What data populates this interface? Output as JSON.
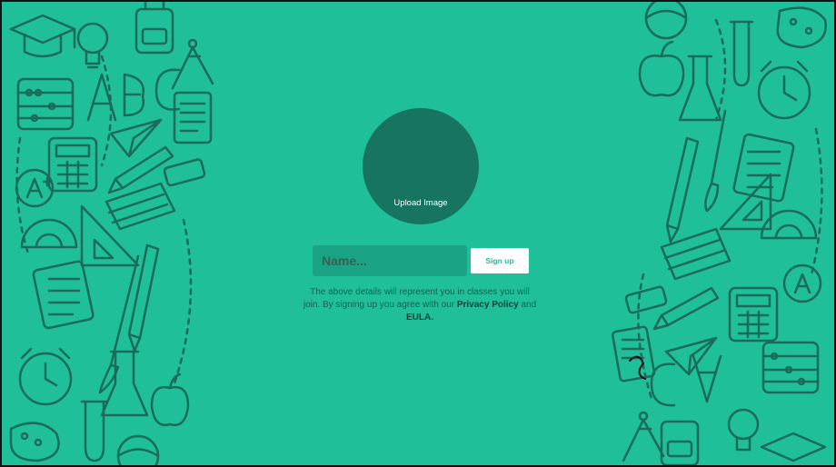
{
  "signup": {
    "upload_label": "Upload Image",
    "name_placeholder": "Name...",
    "signup_label": "Sign up",
    "legal_text_1": "The above details will represent you in classes you will join. By signing up you agree with our",
    "privacy_label": "Privacy Policy",
    "and_text": "and",
    "eula_label": "EULA."
  },
  "colors": {
    "background": "#1fbf9a",
    "avatar": "#177460",
    "input": "#1aa384",
    "doodle": "#1a6b5a"
  },
  "icons": [
    "graduation-cap-icon",
    "lightbulb-icon",
    "abacus-icon",
    "abc-letters-icon",
    "paper-plane-icon",
    "calculator-icon",
    "pencil-icon",
    "book-icon",
    "ruler-triangle-icon",
    "alarm-clock-icon",
    "apple-icon",
    "paintbrush-icon",
    "flask-icon",
    "compass-icon"
  ]
}
